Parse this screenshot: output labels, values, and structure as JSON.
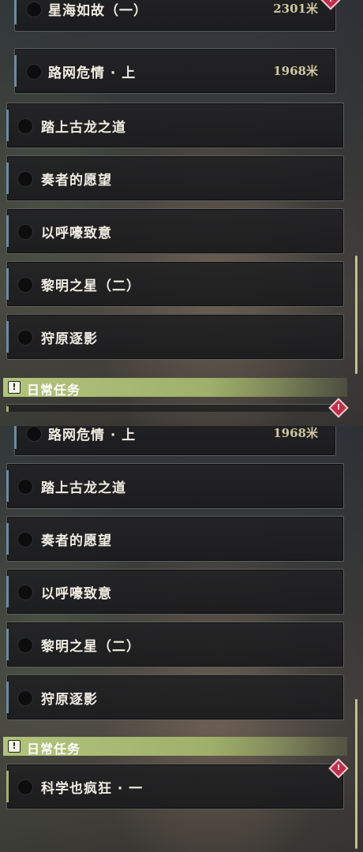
{
  "top_panel": {
    "sub_quests": [
      {
        "label": "星海如故（一）",
        "distance": "2301米"
      },
      {
        "label": "路网危情 · 上",
        "distance": "1968米"
      }
    ],
    "quests": [
      {
        "label": "踏上古龙之道"
      },
      {
        "label": "奏者的愿望"
      },
      {
        "label": "以呼嚎致意"
      },
      {
        "label": "黎明之星（二）"
      },
      {
        "label": "狩原逐影"
      }
    ],
    "section_title": "日常任务"
  },
  "bottom_panel": {
    "sub_quest": {
      "label": "路网危情 · 上",
      "distance": "1968米"
    },
    "quests": [
      {
        "label": "踏上古龙之道"
      },
      {
        "label": "奏者的愿望"
      },
      {
        "label": "以呼嚎致意"
      },
      {
        "label": "黎明之星（二）"
      },
      {
        "label": "狩原逐影"
      }
    ],
    "section_title": "日常任务",
    "daily_quest": {
      "label": "科学也疯狂 · 一"
    }
  },
  "icons": {
    "section_icon": "!",
    "warning_icon": "!"
  },
  "colors": {
    "section_bar": "#b2c47c",
    "distance_text": "#cfc79f",
    "warning": "#c0304a",
    "quest_accent": "#6f8aa0"
  }
}
